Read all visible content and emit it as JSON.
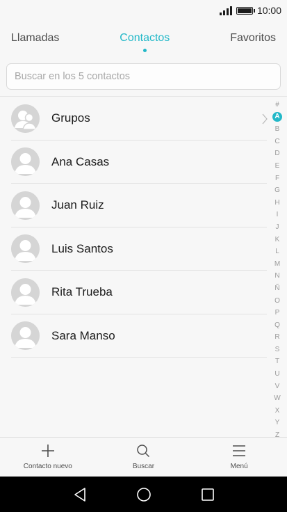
{
  "status": {
    "time": "10:00"
  },
  "tabs": [
    {
      "label": "Llamadas"
    },
    {
      "label": "Contactos",
      "active": true
    },
    {
      "label": "Favoritos"
    }
  ],
  "search": {
    "placeholder": "Buscar en los 5 contactos"
  },
  "contacts": [
    {
      "name": "Grupos",
      "icon": "group-avatar-icon"
    },
    {
      "name": "Ana Casas",
      "icon": "person-avatar-icon"
    },
    {
      "name": "Juan Ruiz",
      "icon": "person-avatar-icon"
    },
    {
      "name": "Luis Santos",
      "icon": "person-avatar-icon"
    },
    {
      "name": "Rita Trueba",
      "icon": "person-avatar-icon"
    },
    {
      "name": "Sara Manso",
      "icon": "person-avatar-icon"
    }
  ],
  "index_letters": [
    "#",
    "A",
    "B",
    "C",
    "D",
    "E",
    "F",
    "G",
    "H",
    "I",
    "J",
    "K",
    "L",
    "M",
    "N",
    "Ñ",
    "O",
    "P",
    "Q",
    "R",
    "S",
    "T",
    "U",
    "V",
    "W",
    "X",
    "Y",
    "Z"
  ],
  "index_active": "A",
  "bottom_actions": [
    {
      "label": "Contacto nuevo",
      "icon": "plus-icon"
    },
    {
      "label": "Buscar",
      "icon": "search-icon"
    },
    {
      "label": "Menú",
      "icon": "menu-icon"
    }
  ],
  "colors": {
    "accent": "#22b8c8"
  }
}
